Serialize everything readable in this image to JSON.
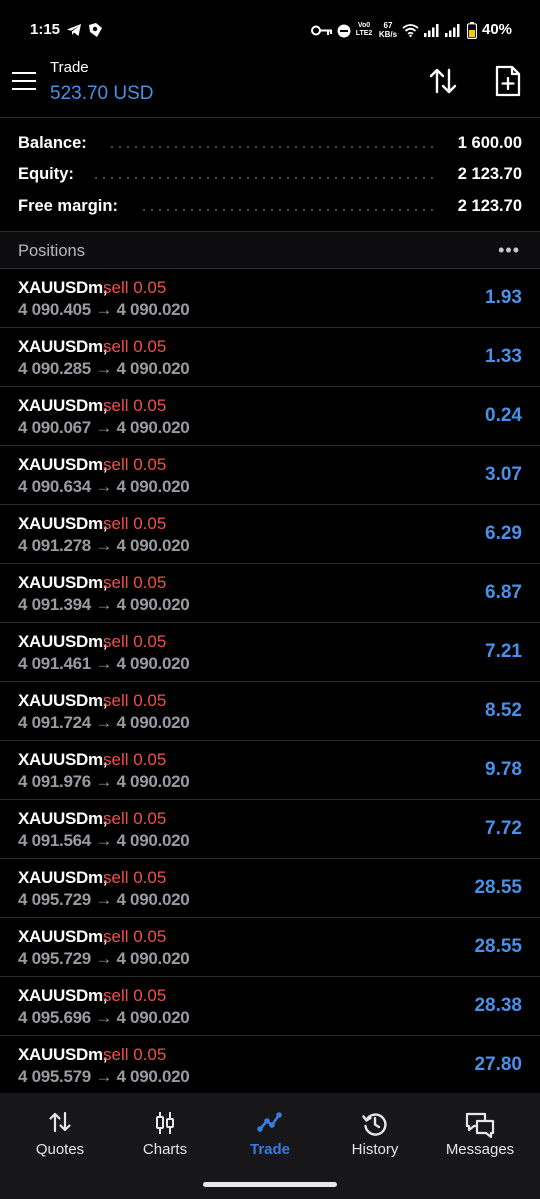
{
  "status": {
    "time": "1:15",
    "net_label_top": "Vo0 LTE2",
    "speed_value": "67",
    "speed_unit": "KB/s",
    "battery": "40%"
  },
  "header": {
    "title": "Trade",
    "value": "523.70 USD",
    "icons": [
      "menu-icon",
      "sort-icon",
      "new-order-icon"
    ]
  },
  "summary": [
    {
      "label": "Balance:",
      "value": "1 600.00"
    },
    {
      "label": "Equity:",
      "value": "2 123.70"
    },
    {
      "label": "Free margin:",
      "value": "2 123.70"
    }
  ],
  "positions": {
    "title": "Positions",
    "more": "•••",
    "rows": [
      {
        "symbol": "XAUUSDm,",
        "side": "sell 0.05",
        "prices": "4 090.405 → 4 090.020",
        "profit": "1.93"
      },
      {
        "symbol": "XAUUSDm,",
        "side": "sell 0.05",
        "prices": "4 090.285 → 4 090.020",
        "profit": "1.33"
      },
      {
        "symbol": "XAUUSDm,",
        "side": "sell 0.05",
        "prices": "4 090.067 → 4 090.020",
        "profit": "0.24"
      },
      {
        "symbol": "XAUUSDm,",
        "side": "sell 0.05",
        "prices": "4 090.634 → 4 090.020",
        "profit": "3.07"
      },
      {
        "symbol": "XAUUSDm,",
        "side": "sell 0.05",
        "prices": "4 091.278 → 4 090.020",
        "profit": "6.29"
      },
      {
        "symbol": "XAUUSDm,",
        "side": "sell 0.05",
        "prices": "4 091.394 → 4 090.020",
        "profit": "6.87"
      },
      {
        "symbol": "XAUUSDm,",
        "side": "sell 0.05",
        "prices": "4 091.461 → 4 090.020",
        "profit": "7.21"
      },
      {
        "symbol": "XAUUSDm,",
        "side": "sell 0.05",
        "prices": "4 091.724 → 4 090.020",
        "profit": "8.52"
      },
      {
        "symbol": "XAUUSDm,",
        "side": "sell 0.05",
        "prices": "4 091.976 → 4 090.020",
        "profit": "9.78"
      },
      {
        "symbol": "XAUUSDm,",
        "side": "sell 0.05",
        "prices": "4 091.564 → 4 090.020",
        "profit": "7.72"
      },
      {
        "symbol": "XAUUSDm,",
        "side": "sell 0.05",
        "prices": "4 095.729 → 4 090.020",
        "profit": "28.55"
      },
      {
        "symbol": "XAUUSDm,",
        "side": "sell 0.05",
        "prices": "4 095.729 → 4 090.020",
        "profit": "28.55"
      },
      {
        "symbol": "XAUUSDm,",
        "side": "sell 0.05",
        "prices": "4 095.696 → 4 090.020",
        "profit": "28.38"
      },
      {
        "symbol": "XAUUSDm,",
        "side": "sell 0.05",
        "prices": "4 095.579 → 4 090.020",
        "profit": "27.80"
      }
    ]
  },
  "nav": [
    {
      "label": "Quotes",
      "icon": "quotes-icon"
    },
    {
      "label": "Charts",
      "icon": "charts-icon"
    },
    {
      "label": "Trade",
      "icon": "trade-icon",
      "active": true
    },
    {
      "label": "History",
      "icon": "history-icon"
    },
    {
      "label": "Messages",
      "icon": "messages-icon"
    }
  ],
  "colors": {
    "accent": "#4a90e8",
    "sell": "#f0504a",
    "background": "#000000",
    "nav_background": "#17171a"
  }
}
